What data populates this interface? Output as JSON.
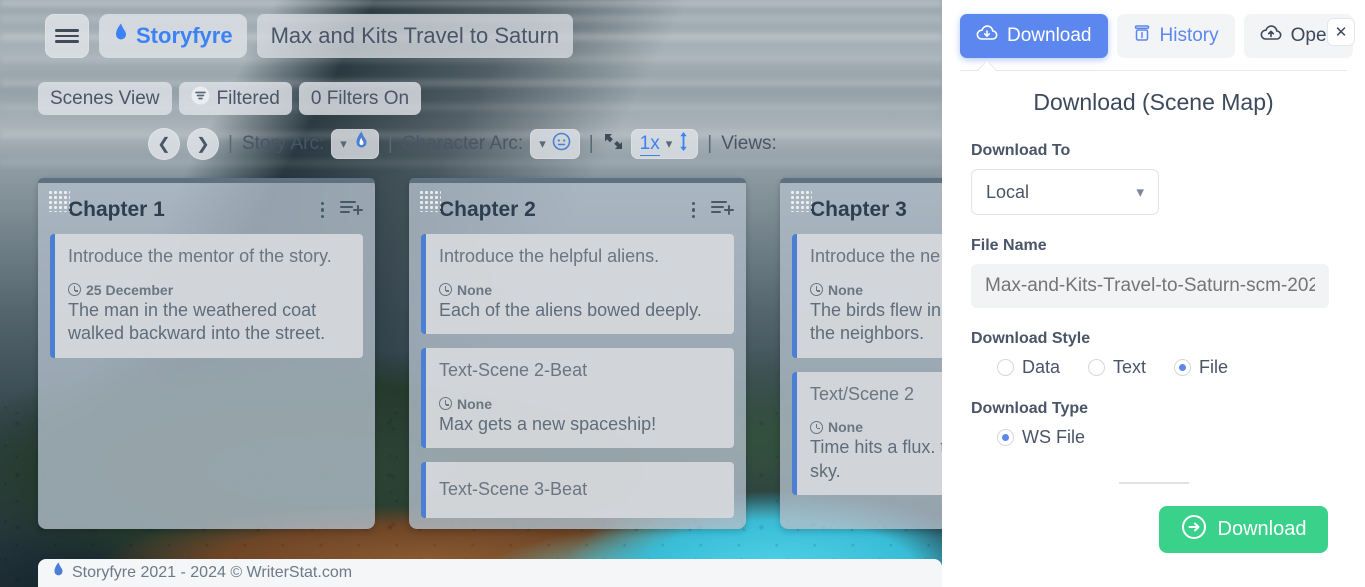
{
  "app": {
    "brand": "Storyfyre",
    "brand_icon": "flame-icon",
    "project_title": "Max and Kits Travel to Saturn",
    "menu_icon": "hamburger-icon"
  },
  "viewbar": {
    "view_mode": "Scenes View",
    "filtered_label": "Filtered",
    "filter_icon": "funnel-icon",
    "filters_count": "0 Filters On"
  },
  "toolbar": {
    "prev_icon": "chevron-left-icon",
    "next_icon": "chevron-right-icon",
    "sep": "|",
    "story_arc_label": "Story Arc:",
    "story_arc_icon": "flame-icon",
    "character_arc_label": "Character Arc:",
    "character_arc_icon": "face-icon",
    "expand_icon": "expand-arrows-icon",
    "zoom_level": "1x",
    "vertical_resize_icon": "up-down-arrow-icon",
    "views_label": "Views:"
  },
  "board": {
    "columns": [
      {
        "title": "Chapter 1",
        "menu_icon": "kebab-menu-icon",
        "add_icon": "add-to-list-icon",
        "cards": [
          {
            "title": "Introduce the mentor of the story.",
            "time_icon": "clock-icon",
            "time": "25 December",
            "body": "The man in the weathered coat walked backward into the street."
          }
        ]
      },
      {
        "title": "Chapter 2",
        "menu_icon": "kebab-menu-icon",
        "add_icon": "add-to-list-icon",
        "cards": [
          {
            "title": "Introduce the helpful aliens.",
            "time_icon": "clock-icon",
            "time": "None",
            "body": "Each of the aliens bowed deeply."
          },
          {
            "title": "Text-Scene 2-Beat",
            "time_icon": "clock-icon",
            "time": "None",
            "body": "Max gets a new spaceship!"
          },
          {
            "title": "Text-Scene 3-Beat",
            "time_icon": "",
            "time": "",
            "body": ""
          }
        ]
      },
      {
        "title": "Chapter 3",
        "menu_icon": "kebab-menu-icon",
        "add_icon": "add-to-list-icon",
        "cards": [
          {
            "title": "Introduce the ne",
            "time_icon": "clock-icon",
            "time": "None",
            "body": "The birds flew in making a terrible the neighbors."
          },
          {
            "title": "Text/Scene 2",
            "time_icon": "clock-icon",
            "time": "None",
            "body": "Time hits a flux. their true colors, sky."
          }
        ]
      }
    ]
  },
  "footer": {
    "icon": "flame-icon",
    "text": "Storyfyre 2021 - 2024 © WriterStat.com"
  },
  "panel": {
    "tabs": [
      {
        "label": "Download",
        "icon": "cloud-download-icon",
        "active": true
      },
      {
        "label": "History",
        "icon": "history-box-icon",
        "active": false
      },
      {
        "label": "Open",
        "icon": "cloud-upload-icon",
        "active": false
      }
    ],
    "close_icon": "close-icon",
    "title": "Download (Scene Map)",
    "download_to": {
      "label": "Download To",
      "value": "Local",
      "chevron_icon": "chevron-down-icon"
    },
    "file_name": {
      "label": "File Name",
      "value": "",
      "placeholder": "Max-and-Kits-Travel-to-Saturn-scm-202"
    },
    "download_style": {
      "label": "Download Style",
      "options": [
        "Data",
        "Text",
        "File"
      ],
      "selected": "File"
    },
    "download_type": {
      "label": "Download Type",
      "options": [
        "WS File"
      ],
      "selected": "WS File"
    },
    "submit": {
      "label": "Download",
      "icon": "arrow-right-circle-icon"
    }
  },
  "colors": {
    "accent_blue": "#5b87ef",
    "brand_blue": "#3b82f6",
    "success_green": "#3ad18a",
    "card_accent": "#4a7fd4",
    "text_dark": "#3d4a5c"
  }
}
